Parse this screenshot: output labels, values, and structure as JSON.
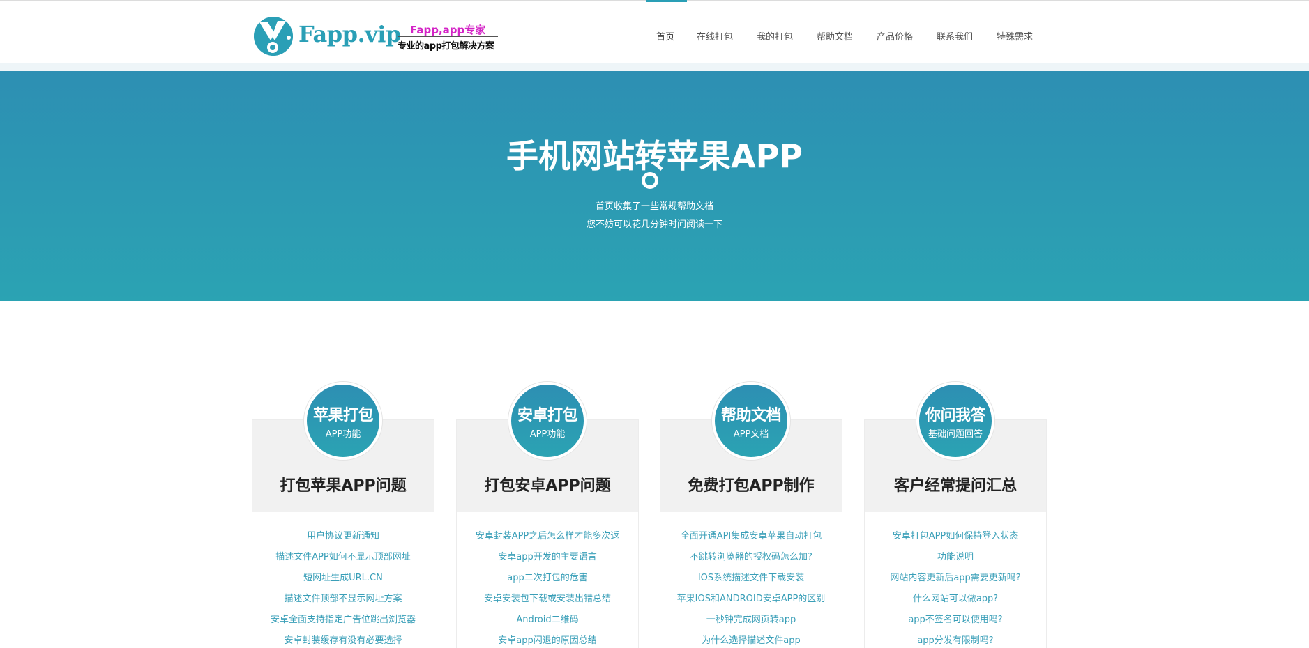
{
  "header": {
    "brand": "Fapp.vip",
    "tagline_top": "Fapp,app专家",
    "tagline_bottom": "专业的app打包解决方案",
    "logo_icon": "logo-icon"
  },
  "nav": {
    "items": [
      {
        "label": "首页",
        "active": true
      },
      {
        "label": "在线打包"
      },
      {
        "label": "我的打包"
      },
      {
        "label": "帮助文档"
      },
      {
        "label": "产品价格"
      },
      {
        "label": "联系我们"
      },
      {
        "label": "特殊需求"
      }
    ],
    "active_color": "#2a9fb6"
  },
  "hero": {
    "title": "手机网站转苹果APP",
    "subtitle_line1": "首页收集了一些常规帮助文档",
    "subtitle_line2": "您不妨可以花几分钟时间阅读一下",
    "gradient_top": "#2d8fb3",
    "gradient_bottom": "#2ba3b3"
  },
  "cards": [
    {
      "circle_main": "苹果打包",
      "circle_sub": "APP功能",
      "title": "打包苹果APP问题",
      "links": [
        "用户协议更新通知",
        "描述文件APP如何不显示顶部网址",
        "短网址生成URL.CN",
        "描述文件顶部不显示网址方案",
        "安卓全面支持指定广告位跳出浏览器",
        "安卓封装缓存有没有必要选择"
      ]
    },
    {
      "circle_main": "安卓打包",
      "circle_sub": "APP功能",
      "title": "打包安卓APP问题",
      "links": [
        "安卓封装APP之后怎么样才能多次返",
        "安卓app开发的主要语言",
        "app二次打包的危害",
        "安卓安装包下载或安装出错总结",
        "Android二维码",
        "安卓app闪退的原因总结"
      ]
    },
    {
      "circle_main": "帮助文档",
      "circle_sub": "APP文档",
      "title": "免费打包APP制作",
      "links": [
        "全面开通API集成安卓苹果自动打包",
        "不跳转浏览器的授权码怎么加?",
        "IOS系统描述文件下载安装",
        "苹果IOS和ANDROID安卓APP的区别",
        "一秒钟完成网页转app",
        "为什么选择描述文件app"
      ]
    },
    {
      "circle_main": "你问我答",
      "circle_sub": "基础问题回答",
      "title": "客户经常提问汇总",
      "links": [
        "安卓打包APP如何保持登入状态",
        "功能说明",
        "网站内容更新后app需要更新吗?",
        "什么网站可以做app?",
        "app不签名可以使用吗?",
        "app分发有限制吗?"
      ]
    }
  ],
  "link_color": "#3a9fb8"
}
